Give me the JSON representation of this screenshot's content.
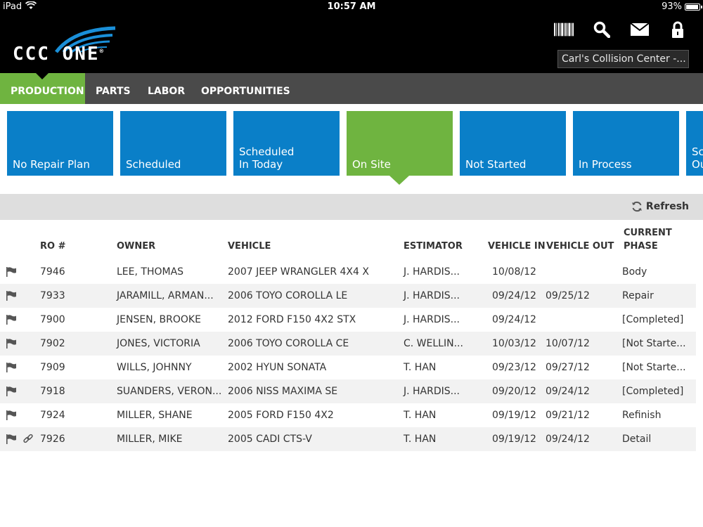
{
  "status_bar": {
    "device": "iPad",
    "time": "10:57 AM",
    "battery": "93%"
  },
  "header": {
    "logo_text": "CCC ONE",
    "logo_mark": "®",
    "icons": [
      "barcode-icon",
      "search-icon",
      "mail-icon",
      "lock-icon"
    ],
    "location": "Carl's Collision Center -..."
  },
  "nav": {
    "items": [
      {
        "label": "PRODUCTION",
        "active": true
      },
      {
        "label": "PARTS",
        "active": false
      },
      {
        "label": "LABOR",
        "active": false
      },
      {
        "label": "OPPORTUNITIES",
        "active": false
      }
    ]
  },
  "tiles": [
    {
      "label": "No Repair Plan",
      "active": false
    },
    {
      "label": "Scheduled",
      "active": false
    },
    {
      "label": "Scheduled\nIn Today",
      "active": false
    },
    {
      "label": "On Site",
      "active": true
    },
    {
      "label": "Not Started",
      "active": false
    },
    {
      "label": "In Process",
      "active": false
    },
    {
      "label": "Sc\nOu",
      "active": false
    }
  ],
  "toolbar": {
    "refresh_label": "Refresh"
  },
  "table": {
    "columns": [
      "RO #",
      "OWNER",
      "VEHICLE",
      "ESTIMATOR",
      "VEHICLE IN",
      "VEHICLE OUT",
      "CURRENT\nPHASE"
    ],
    "rows": [
      {
        "ro": "7946",
        "owner": "LEE, THOMAS",
        "vehicle": "2007 JEEP WRANGLER 4X4 X",
        "estimator": "J. HARDIS...",
        "vin": "10/08/12",
        "vout": "",
        "phase": "Body",
        "link": false
      },
      {
        "ro": "7933",
        "owner": "JARAMILL, ARMAN...",
        "vehicle": "2006 TOYO COROLLA LE",
        "estimator": "J. HARDIS...",
        "vin": "09/24/12",
        "vout": "09/25/12",
        "phase": "Repair",
        "link": false
      },
      {
        "ro": "7900",
        "owner": "JENSEN, BROOKE",
        "vehicle": "2012 FORD F150 4X2 STX",
        "estimator": "J. HARDIS...",
        "vin": "09/24/12",
        "vout": "",
        "phase": "[Completed]",
        "link": false
      },
      {
        "ro": "7902",
        "owner": "JONES, VICTORIA",
        "vehicle": "2006 TOYO COROLLA CE",
        "estimator": "C. WELLIN...",
        "vin": "10/03/12",
        "vout": "10/07/12",
        "phase": "[Not Starte...",
        "link": false
      },
      {
        "ro": "7909",
        "owner": "WILLS, JOHNNY",
        "vehicle": "2002 HYUN SONATA",
        "estimator": "T. HAN",
        "vin": "09/23/12",
        "vout": "09/27/12",
        "phase": "[Not Starte...",
        "link": false
      },
      {
        "ro": "7918",
        "owner": "SUANDERS, VERON...",
        "vehicle": "2006 NISS MAXIMA SE",
        "estimator": "J. HARDIS...",
        "vin": "09/20/12",
        "vout": "09/24/12",
        "phase": "[Completed]",
        "link": false
      },
      {
        "ro": "7924",
        "owner": "MILLER, SHANE",
        "vehicle": "2005 FORD F150 4X2",
        "estimator": "T. HAN",
        "vin": "09/19/12",
        "vout": "09/21/12",
        "phase": "Refinish",
        "link": false
      },
      {
        "ro": "7926",
        "owner": "MILLER, MIKE",
        "vehicle": "2005 CADI CTS-V",
        "estimator": "T. HAN",
        "vin": "09/19/12",
        "vout": "09/24/12",
        "phase": "Detail",
        "link": true
      }
    ]
  },
  "colors": {
    "accent_green": "#6fb440",
    "tile_blue": "#0a7fc8",
    "nav_gray": "#4a4a4a",
    "logo_blue": "#1a8fd8"
  }
}
